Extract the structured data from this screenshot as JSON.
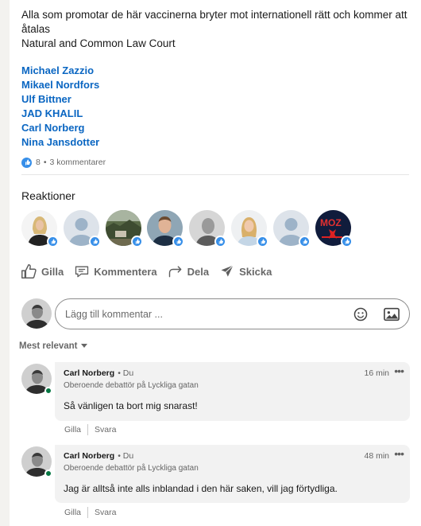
{
  "post": {
    "text_line1": "Alla som promotar de här vaccinerna bryter mot internationell rätt och kommer att åtalas",
    "text_line2": "Natural and Common Law Court",
    "mentions": [
      "Michael Zazzio",
      "Mikael Nordfors",
      "Ulf Bittner",
      "JAD KHALIL",
      "Carl Norberg",
      "Nina Jansdotter"
    ],
    "reaction_count": "8",
    "separator": "•",
    "comment_count": "3 kommentarer"
  },
  "reactions": {
    "title": "Reaktioner",
    "reactors": [
      {
        "avatar": "woman-blonde-avatar"
      },
      {
        "avatar": "default-person-avatar"
      },
      {
        "avatar": "landscape-avatar"
      },
      {
        "avatar": "man-photo-avatar"
      },
      {
        "avatar": "man-grayscale-avatar"
      },
      {
        "avatar": "woman-photo-avatar"
      },
      {
        "avatar": "default-person-avatar"
      },
      {
        "avatar": "moz-logo-avatar",
        "logo_text": "MOZ"
      }
    ]
  },
  "actions": {
    "like": "Gilla",
    "comment": "Kommentera",
    "share": "Dela",
    "send": "Skicka"
  },
  "composer": {
    "placeholder": "Lägg till kommentar ..."
  },
  "sort": {
    "label": "Mest relevant"
  },
  "comments": [
    {
      "name": "Carl Norberg",
      "degree": "• Du",
      "headline": "Oberoende debattör på Lyckliga gatan",
      "time": "16 min",
      "more": "•••",
      "text": "Så vänligen ta bort mig snarast!",
      "like_label": "Gilla",
      "reply_label": "Svara"
    },
    {
      "name": "Carl Norberg",
      "degree": "• Du",
      "headline": "Oberoende debattör på Lyckliga gatan",
      "time": "48 min",
      "more": "•••",
      "text": "Jag är alltså inte alls inblandad i den här saken, vill jag förtydliga.",
      "like_label": "Gilla",
      "reply_label": "Svara"
    }
  ],
  "colors": {
    "link": "#0a66c2",
    "like_blue": "#378fe9",
    "online_green": "#057642",
    "bubble_bg": "#f2f2f2"
  }
}
